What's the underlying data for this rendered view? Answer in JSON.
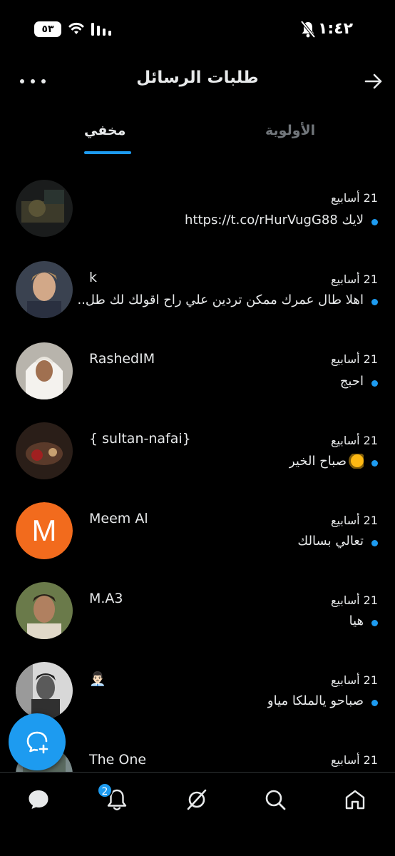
{
  "status_bar": {
    "battery": "٥٣",
    "time": "١:٤٢"
  },
  "header": {
    "title": "طلبات الرسائل"
  },
  "tabs": [
    {
      "label": "مخفي",
      "active": true
    },
    {
      "label": "الأولوية",
      "active": false
    }
  ],
  "conversations": [
    {
      "name": "",
      "time": "21 أسابيع",
      "message": "لايك https://t.co/rHurVugG88",
      "unread": true
    },
    {
      "name": "k",
      "time": "21 أسابيع",
      "message": "اهلا طال عمرك ممكن تردين علي راح اقولك لك طل...",
      "unread": true
    },
    {
      "name": "RashedIM",
      "time": "21 أسابيع",
      "message": "احبج",
      "unread": true
    },
    {
      "name": "{ sultan-nafai}",
      "time": "21 أسابيع",
      "message": "صباح الخير",
      "unread": true
    },
    {
      "name": "Meem Al",
      "avatar_letter": "M",
      "time": "21 أسابيع",
      "message": "تعالي بسالك",
      "unread": true
    },
    {
      "name": "M.A3",
      "time": "21 أسابيع",
      "message": "هيا",
      "unread": true
    },
    {
      "name": "👨🏻‍💼",
      "time": "21 أسابيع",
      "message": "صباحو يالملكا مياو",
      "unread": true
    },
    {
      "name": "The One",
      "time": "21 أسابيع",
      "message": "",
      "unread": false
    }
  ],
  "bottom_nav": {
    "items": [
      "messages-icon",
      "notifications-icon",
      "grok-icon",
      "search-icon",
      "home-icon"
    ],
    "notification_count": "2"
  },
  "colors": {
    "accent": "#1d9bf0",
    "background": "#000000",
    "text": "#e7e9ea",
    "muted": "#71767b",
    "avatar_m": "#f26b1d"
  }
}
